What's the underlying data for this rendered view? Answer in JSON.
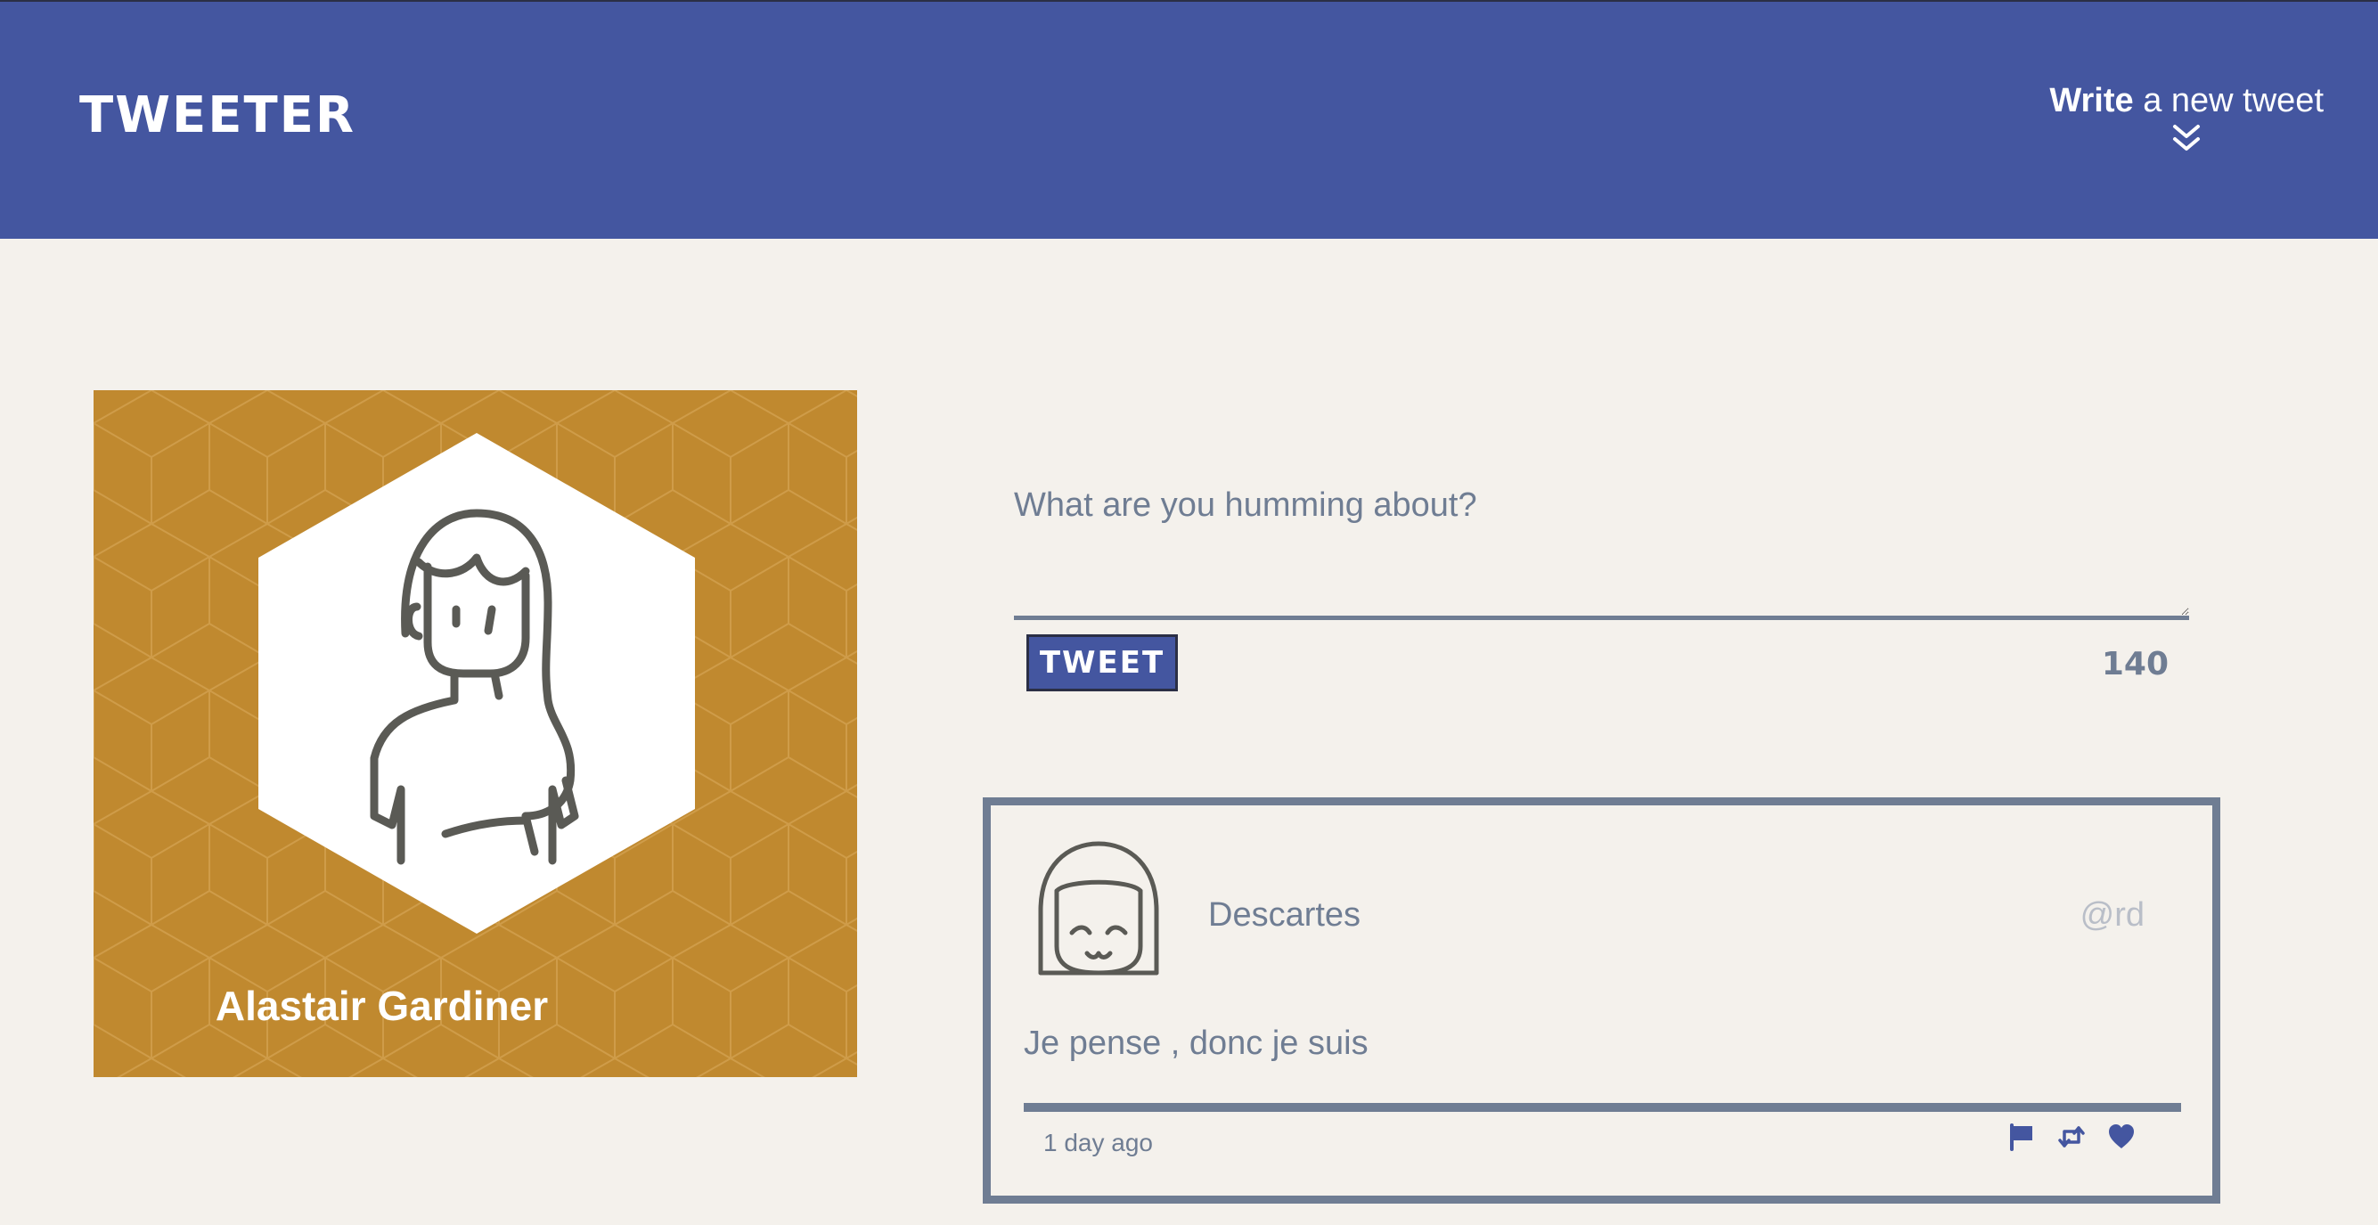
{
  "header": {
    "brand": "TWEETER",
    "compose_toggle": {
      "strong": "Write",
      "rest": " a new tweet",
      "icon": "double-chevron-down-icon"
    }
  },
  "profile": {
    "name": "Alastair Gardiner",
    "avatar_icon": "woman-avatar-icon",
    "background_color": "#c0892f"
  },
  "compose": {
    "placeholder": "What are you humming about?",
    "value": "",
    "button_label": "TWEET",
    "counter": "140"
  },
  "tweets": [
    {
      "author": "Descartes",
      "handle": "@rd",
      "text": "Je pense , donc je suis",
      "time": "1 day ago",
      "avatar_icon": "girl-avatar-icon",
      "actions": [
        "flag-icon",
        "retweet-icon",
        "heart-icon"
      ]
    }
  ],
  "colors": {
    "accent": "#4456a0",
    "page_bg": "#f4f1ec",
    "muted": "#6f7d93",
    "handle": "#b9bec8",
    "profile_bg": "#c0892f"
  }
}
